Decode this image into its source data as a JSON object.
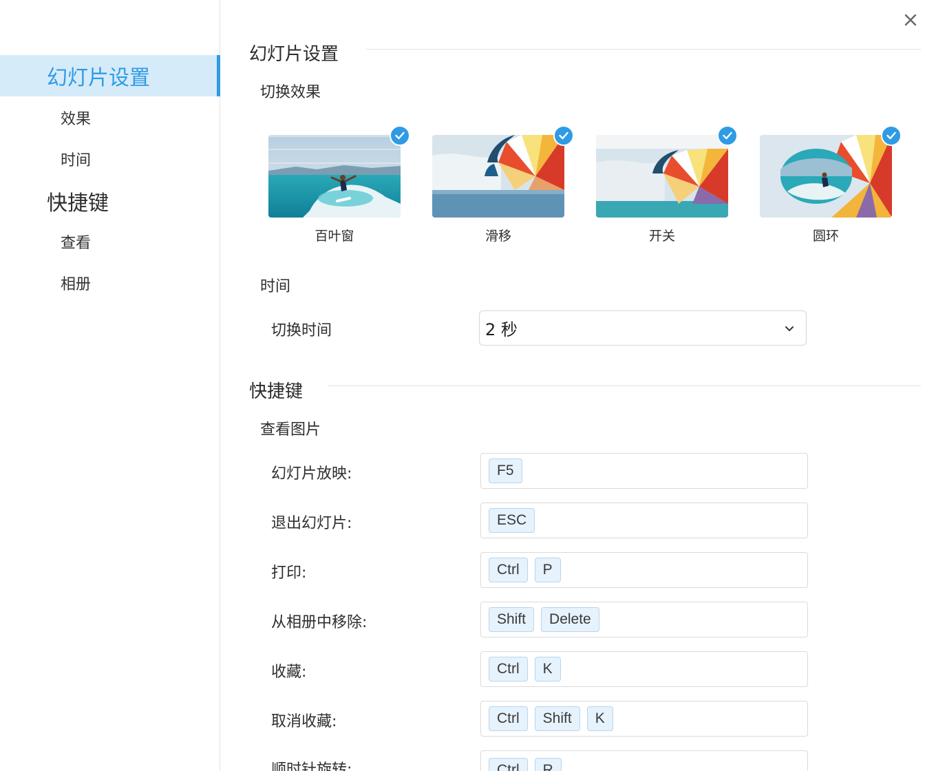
{
  "sidebar": {
    "groups": [
      {
        "label": "幻灯片设置",
        "items": [
          "效果",
          "时间"
        ]
      },
      {
        "label": "快捷键",
        "items": [
          "查看",
          "相册"
        ]
      }
    ]
  },
  "slideshow": {
    "title": "幻灯片设置",
    "transition_title": "切换效果",
    "effects": [
      "百叶窗",
      "滑移",
      "开关",
      "圆环"
    ],
    "time_title": "时间",
    "switch_time_label": "切换时间",
    "switch_time_value": "2 秒"
  },
  "shortcuts": {
    "title": "快捷键",
    "view_title": "查看图片",
    "rows": [
      {
        "label": "幻灯片放映:",
        "keys": [
          "F5"
        ]
      },
      {
        "label": "退出幻灯片:",
        "keys": [
          "ESC"
        ]
      },
      {
        "label": "打印:",
        "keys": [
          "Ctrl",
          "P"
        ]
      },
      {
        "label": "从相册中移除:",
        "keys": [
          "Shift",
          "Delete"
        ]
      },
      {
        "label": "收藏:",
        "keys": [
          "Ctrl",
          "K"
        ]
      },
      {
        "label": "取消收藏:",
        "keys": [
          "Ctrl",
          "Shift",
          "K"
        ]
      },
      {
        "label": "顺时针旋转:",
        "keys": [
          "Ctrl",
          "R"
        ]
      }
    ]
  },
  "colors": {
    "accent": "#2f9be5",
    "active_bg": "#d6ebfa",
    "key_bg": "#e6f2fc"
  },
  "icons": {
    "close": "close-icon",
    "check": "check-icon",
    "dropdown": "chevron-down-icon"
  }
}
